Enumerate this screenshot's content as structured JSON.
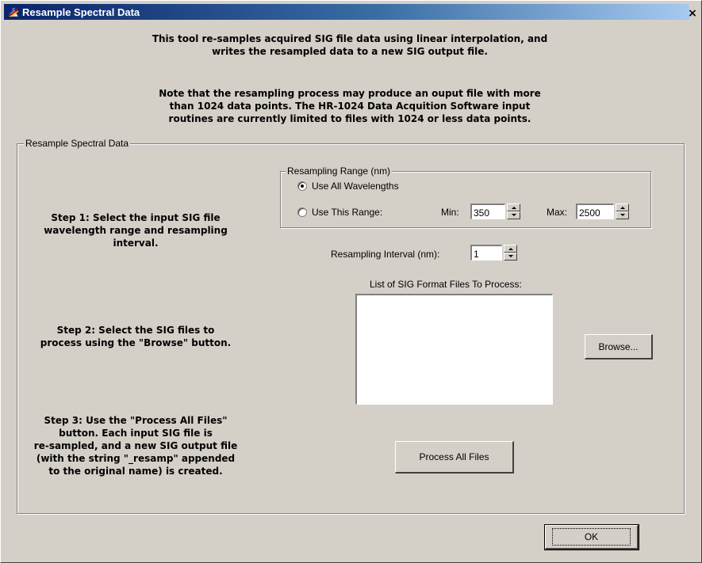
{
  "window": {
    "title": "Resample Spectral Data",
    "close_glyph": "×"
  },
  "intro": {
    "line1": "This tool re-samples acquired SIG file data using linear interpolation, and",
    "line2": "writes the resampled data to a new SIG output file.",
    "note1": "Note that the resampling process may produce an ouput file with more",
    "note2": "than 1024 data points. The HR-1024 Data Acquition Software input",
    "note3": "routines are currently limited to files with 1024 or less data points."
  },
  "main_group": {
    "legend": "Resample Spectral Data"
  },
  "steps": {
    "step1": [
      "Step 1: Select the input SIG file",
      "wavelength range and resampling",
      "interval."
    ],
    "step2": [
      "Step 2: Select the SIG files to",
      "process using the \"Browse\" button."
    ],
    "step3": [
      "Step 3: Use the \"Process All Files\"",
      "button. Each input SIG file is",
      "re-sampled, and a new SIG output file",
      "(with the string \"_resamp\" appended",
      "to the original name) is created."
    ]
  },
  "range_group": {
    "legend": "Resampling Range (nm)",
    "option_all": "Use All Wavelengths",
    "option_range": "Use This Range:",
    "selected": "Use All Wavelengths",
    "min_label": "Min:",
    "min_value": "350",
    "max_label": "Max:",
    "max_value": "2500"
  },
  "interval": {
    "label": "Resampling Interval (nm):",
    "value": "1"
  },
  "file_list": {
    "label": "List of SIG Format Files To Process:",
    "items": []
  },
  "buttons": {
    "browse": "Browse...",
    "process": "Process All Files",
    "ok": "OK"
  },
  "icons": {
    "title_icon": "spectrum-app-icon",
    "close": "close-icon"
  }
}
